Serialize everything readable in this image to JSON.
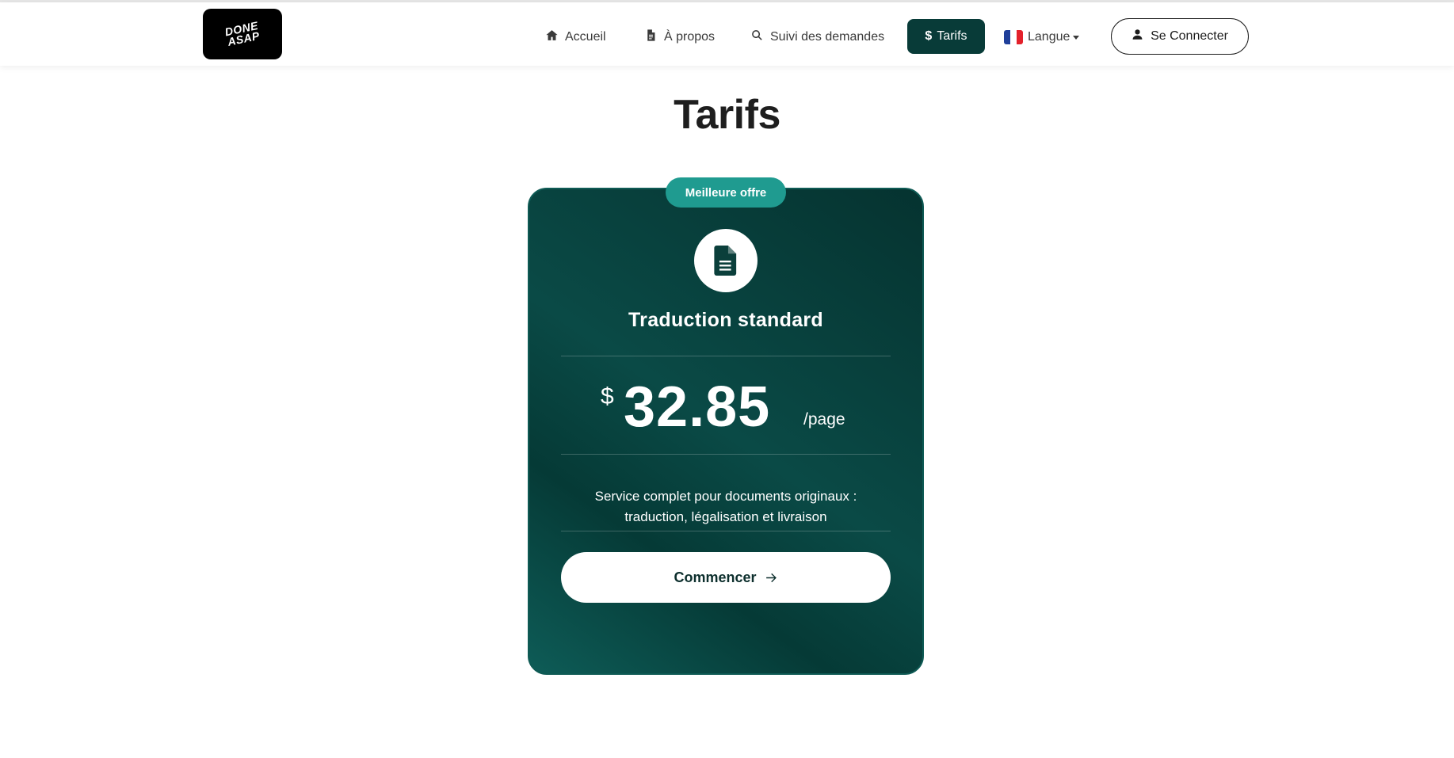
{
  "header": {
    "logo_line1": "DONE",
    "logo_line2": "ASAP",
    "nav": {
      "home": "Accueil",
      "about": "À propos",
      "tracking": "Suivi des demandes",
      "pricing": "Tarifs",
      "language": "Langue"
    },
    "login_label": "Se Connecter",
    "icons": {
      "home": "home-icon",
      "about": "document-icon",
      "tracking": "search-icon",
      "pricing": "dollar-icon",
      "language": "france-flag-icon",
      "login": "user-icon"
    }
  },
  "page": {
    "title": "Tarifs"
  },
  "plan": {
    "badge": "Meilleure offre",
    "icon": "document-icon",
    "name": "Traduction standard",
    "currency": "$",
    "price": "32.85",
    "unit": "/page",
    "description_line1": "Service complet pour documents originaux :",
    "description_line2": "traduction, légalisation et livraison",
    "cta_label": "Commencer",
    "cta_icon": "arrow-right-icon"
  },
  "colors": {
    "accent_dark": "#083b38",
    "badge": "#1f9b90",
    "card_gradient_start": "#053330",
    "card_gradient_end": "#0e5c57"
  }
}
